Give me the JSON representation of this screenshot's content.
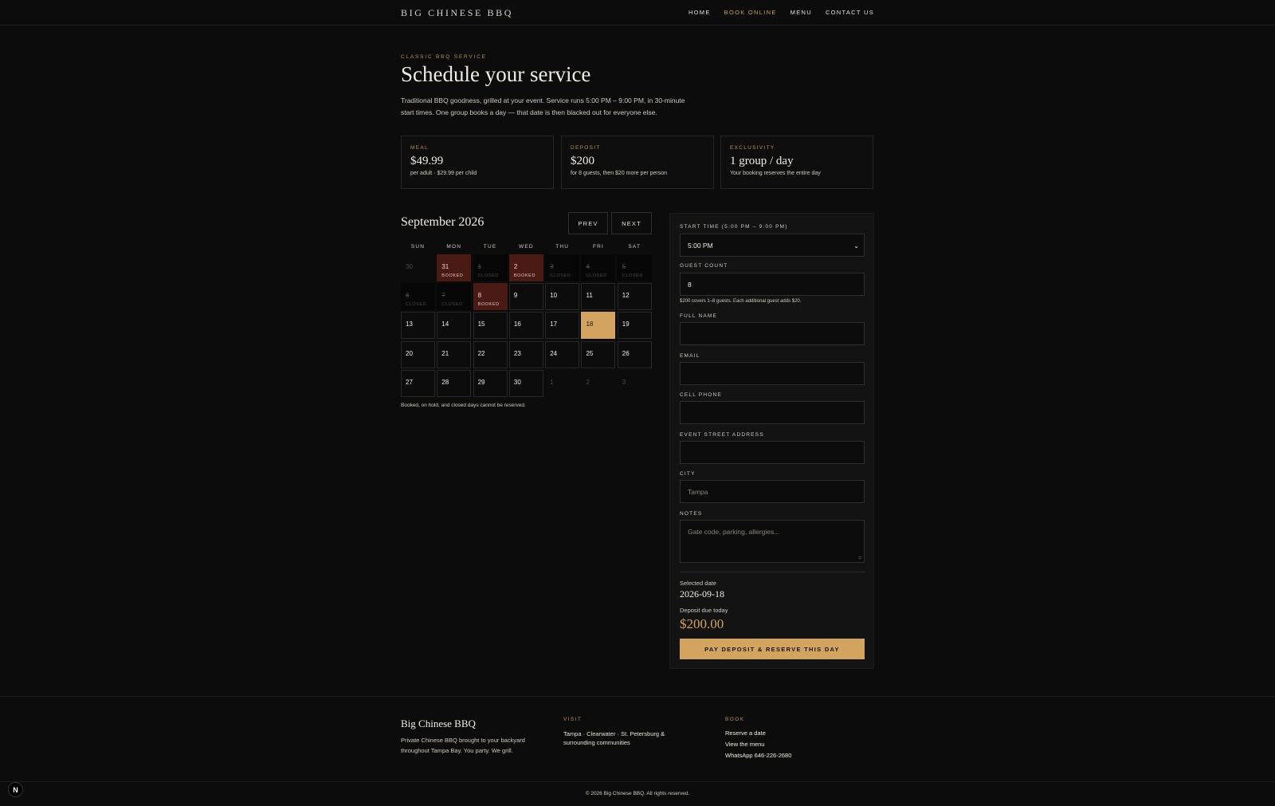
{
  "nav": {
    "brand": "BIG CHINESE BBQ",
    "links": [
      {
        "label": "HOME",
        "active": false
      },
      {
        "label": "BOOK ONLINE",
        "active": true
      },
      {
        "label": "MENU",
        "active": false
      },
      {
        "label": "CONTACT US",
        "active": false
      }
    ]
  },
  "hero": {
    "eyebrow": "CLASSIC BBQ SERVICE",
    "title": "Schedule your service",
    "intro": "Traditional BBQ goodness, grilled at your event. Service runs 5:00 PM – 9:00 PM, in 30-minute start times. One group books a day — that date is then blacked out for everyone else."
  },
  "cards": [
    {
      "label": "MEAL",
      "value": "$49.99",
      "sub": "per adult · $29.99 per child"
    },
    {
      "label": "DEPOSIT",
      "value": "$200",
      "sub": "for 8 guests, then $20 more per person"
    },
    {
      "label": "EXCLUSIVITY",
      "value": "1 group / day",
      "sub": "Your booking reserves the entire day"
    }
  ],
  "calendar": {
    "month_label": "September 2026",
    "prev_label": "PREV",
    "next_label": "NEXT",
    "weekdays": [
      "SUN",
      "MON",
      "TUE",
      "WED",
      "THU",
      "FRI",
      "SAT"
    ],
    "days": [
      {
        "n": "30",
        "state": "outside",
        "status": ""
      },
      {
        "n": "31",
        "state": "booked",
        "status": "BOOKED"
      },
      {
        "n": "1",
        "state": "closed",
        "status": "CLOSED"
      },
      {
        "n": "2",
        "state": "booked",
        "status": "BOOKED"
      },
      {
        "n": "3",
        "state": "closed",
        "status": "CLOSED"
      },
      {
        "n": "4",
        "state": "closed",
        "status": "CLOSED"
      },
      {
        "n": "5",
        "state": "closed",
        "status": "CLOSED"
      },
      {
        "n": "6",
        "state": "closed",
        "status": "CLOSED"
      },
      {
        "n": "7",
        "state": "closed",
        "status": "CLOSED"
      },
      {
        "n": "8",
        "state": "booked",
        "status": "BOOKED"
      },
      {
        "n": "9",
        "state": "open",
        "status": ""
      },
      {
        "n": "10",
        "state": "open",
        "status": ""
      },
      {
        "n": "11",
        "state": "open",
        "status": ""
      },
      {
        "n": "12",
        "state": "open",
        "status": ""
      },
      {
        "n": "13",
        "state": "open",
        "status": ""
      },
      {
        "n": "14",
        "state": "open",
        "status": ""
      },
      {
        "n": "15",
        "state": "open",
        "status": ""
      },
      {
        "n": "16",
        "state": "open",
        "status": ""
      },
      {
        "n": "17",
        "state": "open",
        "status": ""
      },
      {
        "n": "18",
        "state": "selected",
        "status": ""
      },
      {
        "n": "19",
        "state": "open",
        "status": ""
      },
      {
        "n": "20",
        "state": "open",
        "status": ""
      },
      {
        "n": "21",
        "state": "open",
        "status": ""
      },
      {
        "n": "22",
        "state": "open",
        "status": ""
      },
      {
        "n": "23",
        "state": "open",
        "status": ""
      },
      {
        "n": "24",
        "state": "open",
        "status": ""
      },
      {
        "n": "25",
        "state": "open",
        "status": ""
      },
      {
        "n": "26",
        "state": "open",
        "status": ""
      },
      {
        "n": "27",
        "state": "open",
        "status": ""
      },
      {
        "n": "28",
        "state": "open",
        "status": ""
      },
      {
        "n": "29",
        "state": "open",
        "status": ""
      },
      {
        "n": "30",
        "state": "open",
        "status": ""
      },
      {
        "n": "1",
        "state": "outside",
        "status": ""
      },
      {
        "n": "2",
        "state": "outside",
        "status": ""
      },
      {
        "n": "3",
        "state": "outside",
        "status": ""
      }
    ],
    "note": "Booked, on hold, and closed days cannot be reserved."
  },
  "form": {
    "start_time_label": "START TIME (5:00 PM – 9:00 PM)",
    "start_time_value": "5:00 PM",
    "guest_count_label": "GUEST COUNT",
    "guest_count_value": "8",
    "guest_hint": "$200 covers 1–8 guests. Each additional guest adds $20.",
    "full_name_label": "FULL NAME",
    "full_name_value": "",
    "email_label": "EMAIL",
    "email_value": "",
    "phone_label": "CELL PHONE",
    "phone_value": "",
    "address_label": "EVENT STREET ADDRESS",
    "address_value": "",
    "city_label": "CITY",
    "city_placeholder": "Tampa",
    "notes_label": "NOTES",
    "notes_placeholder": "Gate code, parking, allergies..."
  },
  "summary": {
    "selected_date_label": "Selected date",
    "selected_date": "2026-09-18",
    "deposit_label": "Deposit due today",
    "deposit_value": "$200.00",
    "pay_button": "PAY DEPOSIT & RESERVE THIS DAY"
  },
  "footer": {
    "brand": "Big Chinese BBQ",
    "tagline": "Private Chinese BBQ brought to your backyard throughout Tampa Bay. You party. We grill.",
    "visit_heading": "VISIT",
    "visit_text": "Tampa · Clearwater · St. Petersburg & surrounding communities",
    "book_heading": "BOOK",
    "book_links": [
      "Reserve a date",
      "View the menu",
      "WhatsApp 646-226-2680"
    ],
    "copyright": "© 2026 Big Chinese BBQ. All rights reserved.",
    "badge": "N"
  },
  "colors": {
    "background": "#0c0c0c",
    "accent": "#d3a45f",
    "booked": "#4a1b14"
  }
}
